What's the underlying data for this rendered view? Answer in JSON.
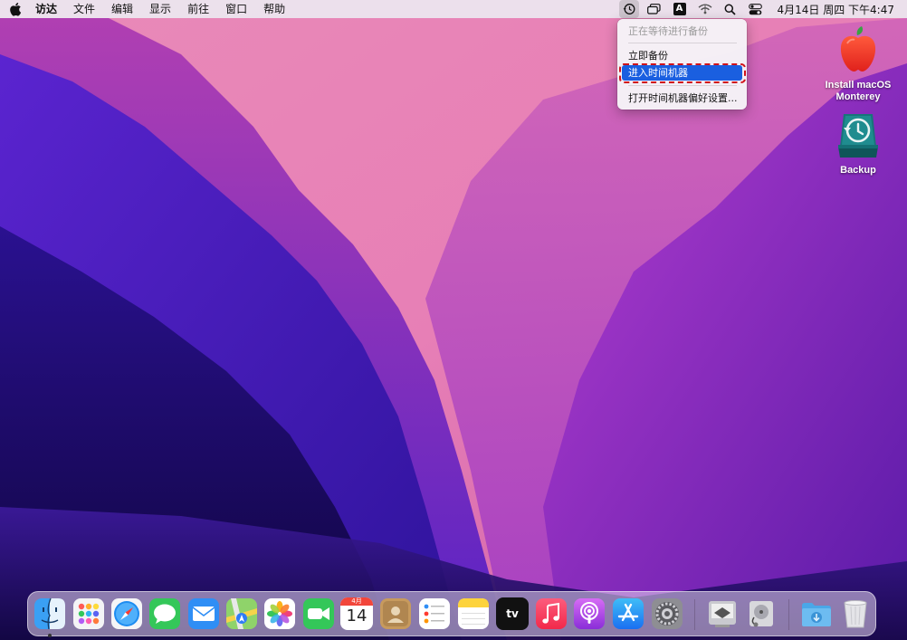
{
  "menubar": {
    "app_name": "访达",
    "menus": [
      "文件",
      "编辑",
      "显示",
      "前往",
      "窗口",
      "帮助"
    ],
    "icons": [
      "time-machine-icon",
      "window-icon",
      "input-method-icon",
      "wifi-icon",
      "spotlight-search-icon",
      "control-center-icon"
    ],
    "input_method_letter": "A",
    "clock": "4月14日 周四 下午4:47"
  },
  "time_machine_menu": {
    "status": "正在等待进行备份",
    "items": [
      "立即备份",
      "进入时间机器",
      "打开时间机器偏好设置..."
    ],
    "selected_index": 1
  },
  "desktop_icons": [
    {
      "label_line1": "Install macOS",
      "label_line2": "Monterey",
      "icon": "macos-installer-icon"
    },
    {
      "label_line1": "Backup",
      "label_line2": "",
      "icon": "time-machine-drive-icon"
    }
  ],
  "dock": {
    "apps": [
      "finder-icon",
      "launchpad-icon",
      "safari-icon",
      "messages-icon",
      "mail-icon",
      "maps-icon",
      "photos-icon",
      "facetime-icon",
      "calendar-icon",
      "contacts-icon",
      "reminders-icon",
      "notes-icon",
      "tv-icon",
      "music-icon",
      "podcasts-icon",
      "app-store-icon",
      "system-preferences-icon",
      "migration-assistant-icon",
      "disk-utility-icon",
      "downloads-folder-icon",
      "trash-icon"
    ],
    "calendar_month": "4月",
    "calendar_day": "14",
    "tv_label": "tv"
  },
  "colors": {
    "menu_selected": "#1a5fe0",
    "highlight_border": "#d0121b"
  }
}
